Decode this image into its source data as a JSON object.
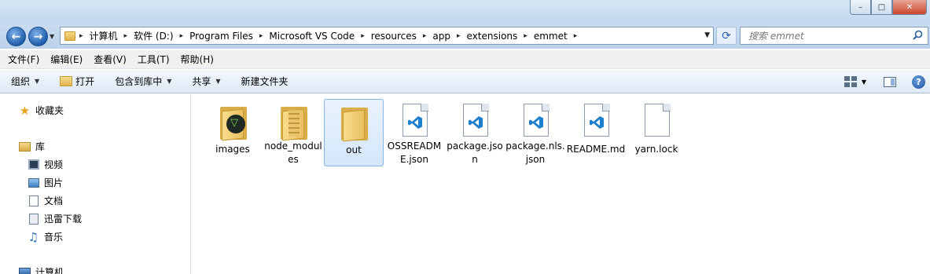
{
  "window": {
    "controls": {
      "minimize": "–",
      "maximize": "□",
      "close": "✕"
    }
  },
  "address": {
    "root_sep": "▸",
    "crumbs": [
      "计算机",
      "软件 (D:)",
      "Program Files",
      "Microsoft VS Code",
      "resources",
      "app",
      "extensions",
      "emmet"
    ],
    "refresh": "⟳",
    "search_placeholder": "搜索 emmet"
  },
  "menu": [
    "文件(F)",
    "编辑(E)",
    "查看(V)",
    "工具(T)",
    "帮助(H)"
  ],
  "toolbar": {
    "organize": "组织",
    "open": "打开",
    "include": "包含到库中",
    "share": "共享",
    "new_folder": "新建文件夹",
    "help": "?"
  },
  "nav": {
    "favorites": "收藏夹",
    "libraries": "库",
    "videos": "视频",
    "pictures": "图片",
    "documents": "文档",
    "thunder": "迅雷下载",
    "music": "音乐",
    "computer": "计算机"
  },
  "files": [
    {
      "name": "images",
      "type": "folder-emmet"
    },
    {
      "name": "node_modules",
      "type": "folder-papers"
    },
    {
      "name": "out",
      "type": "folder",
      "selected": true
    },
    {
      "name": "OSSREADME.json",
      "type": "vscode-json"
    },
    {
      "name": "package.json",
      "type": "vscode-json"
    },
    {
      "name": "package.nls.json",
      "type": "vscode-json"
    },
    {
      "name": "README.md",
      "type": "vscode-md"
    },
    {
      "name": "yarn.lock",
      "type": "blank-file"
    }
  ],
  "colors": {
    "vscode_blue": "#1f7fcf",
    "selection": "#d4e6fb"
  }
}
